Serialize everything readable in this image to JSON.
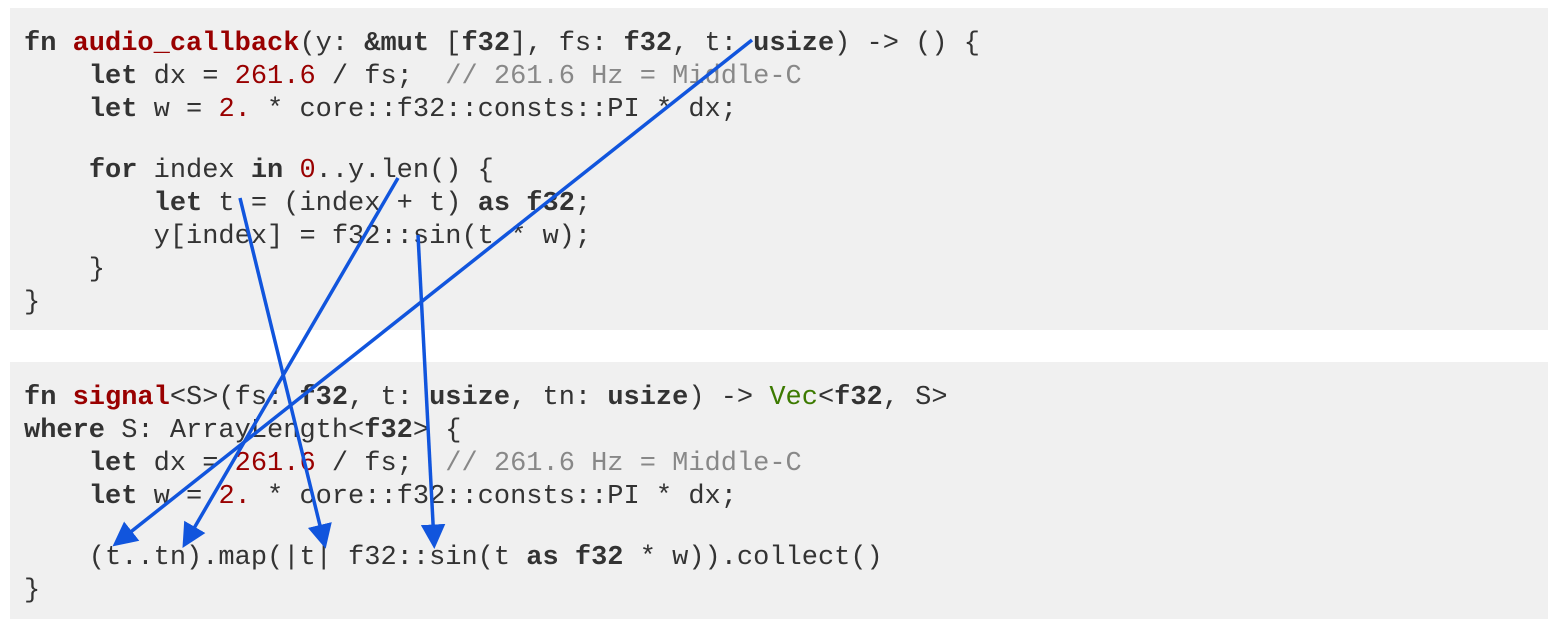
{
  "block1": {
    "lines": [
      [
        {
          "t": "fn",
          "c": "kw"
        },
        {
          "t": " "
        },
        {
          "t": "audio_callback",
          "c": "fn"
        },
        {
          "t": "(y: "
        },
        {
          "t": "&mut",
          "c": "kw"
        },
        {
          "t": " ["
        },
        {
          "t": "f32",
          "c": "kw"
        },
        {
          "t": "], fs: "
        },
        {
          "t": "f32",
          "c": "kw"
        },
        {
          "t": ", t: "
        },
        {
          "t": "usize",
          "c": "kw"
        },
        {
          "t": ") -> () {"
        }
      ],
      [
        {
          "t": "    "
        },
        {
          "t": "let",
          "c": "kw"
        },
        {
          "t": " dx = "
        },
        {
          "t": "261.6",
          "c": "num"
        },
        {
          "t": " / fs;  "
        },
        {
          "t": "// 261.6 Hz = Middle-C",
          "c": "cmt"
        }
      ],
      [
        {
          "t": "    "
        },
        {
          "t": "let",
          "c": "kw"
        },
        {
          "t": " w = "
        },
        {
          "t": "2.",
          "c": "num"
        },
        {
          "t": " * core::f32::consts::PI * dx;"
        }
      ],
      [],
      [
        {
          "t": "    "
        },
        {
          "t": "for",
          "c": "kw"
        },
        {
          "t": " index "
        },
        {
          "t": "in",
          "c": "kw"
        },
        {
          "t": " "
        },
        {
          "t": "0",
          "c": "num"
        },
        {
          "t": "..y.len() {"
        }
      ],
      [
        {
          "t": "        "
        },
        {
          "t": "let",
          "c": "kw"
        },
        {
          "t": " t = (index + t) "
        },
        {
          "t": "as",
          "c": "kw"
        },
        {
          "t": " "
        },
        {
          "t": "f32",
          "c": "kw"
        },
        {
          "t": ";"
        }
      ],
      [
        {
          "t": "        y[index] = f32::sin(t * w);"
        }
      ],
      [
        {
          "t": "    }"
        }
      ],
      [
        {
          "t": "}"
        }
      ]
    ]
  },
  "block2": {
    "lines": [
      [
        {
          "t": "fn",
          "c": "kw"
        },
        {
          "t": " "
        },
        {
          "t": "signal",
          "c": "fn"
        },
        {
          "t": "<S>(fs: "
        },
        {
          "t": "f32",
          "c": "kw"
        },
        {
          "t": ", t: "
        },
        {
          "t": "usize",
          "c": "kw"
        },
        {
          "t": ", tn: "
        },
        {
          "t": "usize",
          "c": "kw"
        },
        {
          "t": ") -> "
        },
        {
          "t": "Vec",
          "c": "ty"
        },
        {
          "t": "<"
        },
        {
          "t": "f32",
          "c": "kw"
        },
        {
          "t": ", S>"
        }
      ],
      [
        {
          "t": "where",
          "c": "kw"
        },
        {
          "t": " S: ArrayLength<"
        },
        {
          "t": "f32",
          "c": "kw"
        },
        {
          "t": "> {"
        }
      ],
      [
        {
          "t": "    "
        },
        {
          "t": "let",
          "c": "kw"
        },
        {
          "t": " dx = "
        },
        {
          "t": "261.6",
          "c": "num"
        },
        {
          "t": " / fs;  "
        },
        {
          "t": "// 261.6 Hz = Middle-C",
          "c": "cmt"
        }
      ],
      [
        {
          "t": "    "
        },
        {
          "t": "let",
          "c": "kw"
        },
        {
          "t": " w = "
        },
        {
          "t": "2.",
          "c": "num"
        },
        {
          "t": " * core::f32::consts::PI * dx;"
        }
      ],
      [],
      [
        {
          "t": "    (t..tn).map(|t| f32::sin(t "
        },
        {
          "t": "as",
          "c": "kw"
        },
        {
          "t": " "
        },
        {
          "t": "f32",
          "c": "kw"
        },
        {
          "t": " * w)).collect()"
        }
      ],
      [
        {
          "t": "}"
        }
      ]
    ]
  },
  "arrow_color": "#1155dd"
}
